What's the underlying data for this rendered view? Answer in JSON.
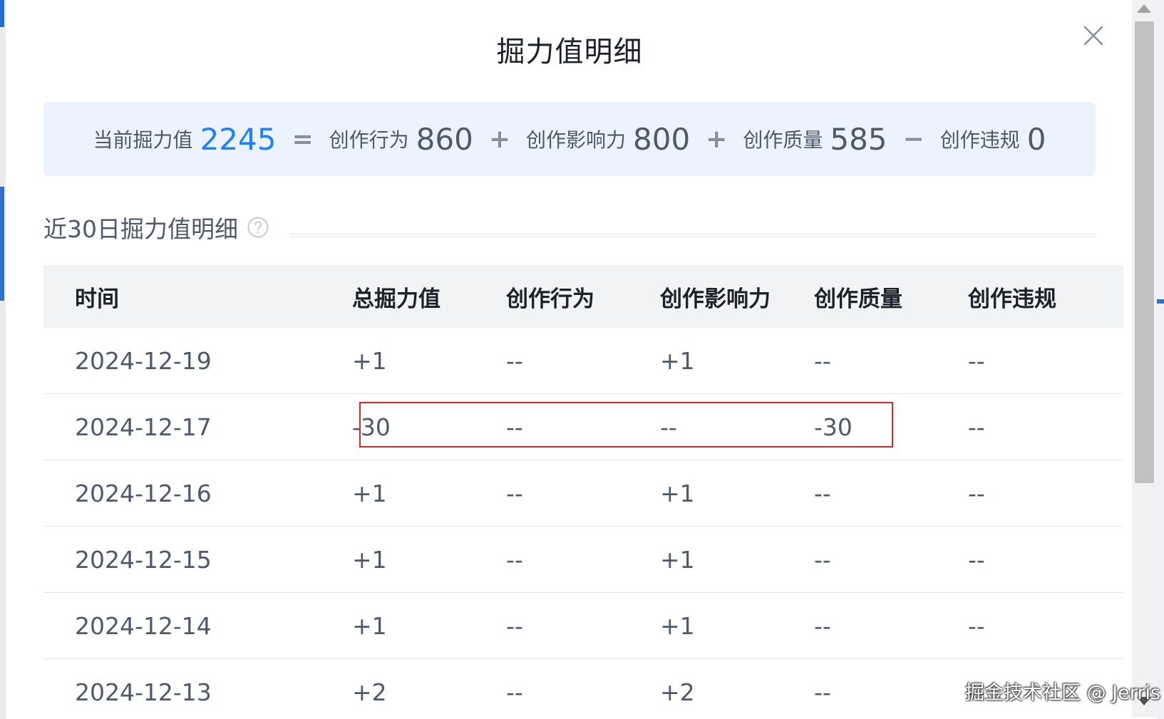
{
  "modal": {
    "title": "掘力值明细"
  },
  "summary": {
    "current_label": "当前掘力值",
    "current_value": "2245",
    "eq": "=",
    "behavior_label": "创作行为",
    "behavior_value": "860",
    "plus1": "+",
    "influence_label": "创作影响力",
    "influence_value": "800",
    "plus2": "+",
    "quality_label": "创作质量",
    "quality_value": "585",
    "minus": "−",
    "violation_label": "创作违规",
    "violation_value": "0"
  },
  "section": {
    "title": "近30日掘力值明细"
  },
  "table": {
    "headers": [
      "时间",
      "总掘力值",
      "创作行为",
      "创作影响力",
      "创作质量",
      "创作违规"
    ],
    "rows": [
      [
        "2024-12-19",
        "+1",
        "--",
        "+1",
        "--",
        "--"
      ],
      [
        "2024-12-17",
        "-30",
        "--",
        "--",
        "-30",
        "--"
      ],
      [
        "2024-12-16",
        "+1",
        "--",
        "+1",
        "--",
        "--"
      ],
      [
        "2024-12-15",
        "+1",
        "--",
        "+1",
        "--",
        "--"
      ],
      [
        "2024-12-14",
        "+1",
        "--",
        "+1",
        "--",
        "--"
      ],
      [
        "2024-12-13",
        "+2",
        "--",
        "+2",
        "--",
        "--"
      ]
    ]
  },
  "watermark": "掘金技术社区 @ Jerris",
  "colors": {
    "primary": "#1e80ff",
    "summary_bg": "#eaf3fe",
    "header_bg": "#f2f3f5",
    "highlight": "#d9252b"
  },
  "icons": {
    "close": "close-icon",
    "help": "question-circle-icon"
  }
}
